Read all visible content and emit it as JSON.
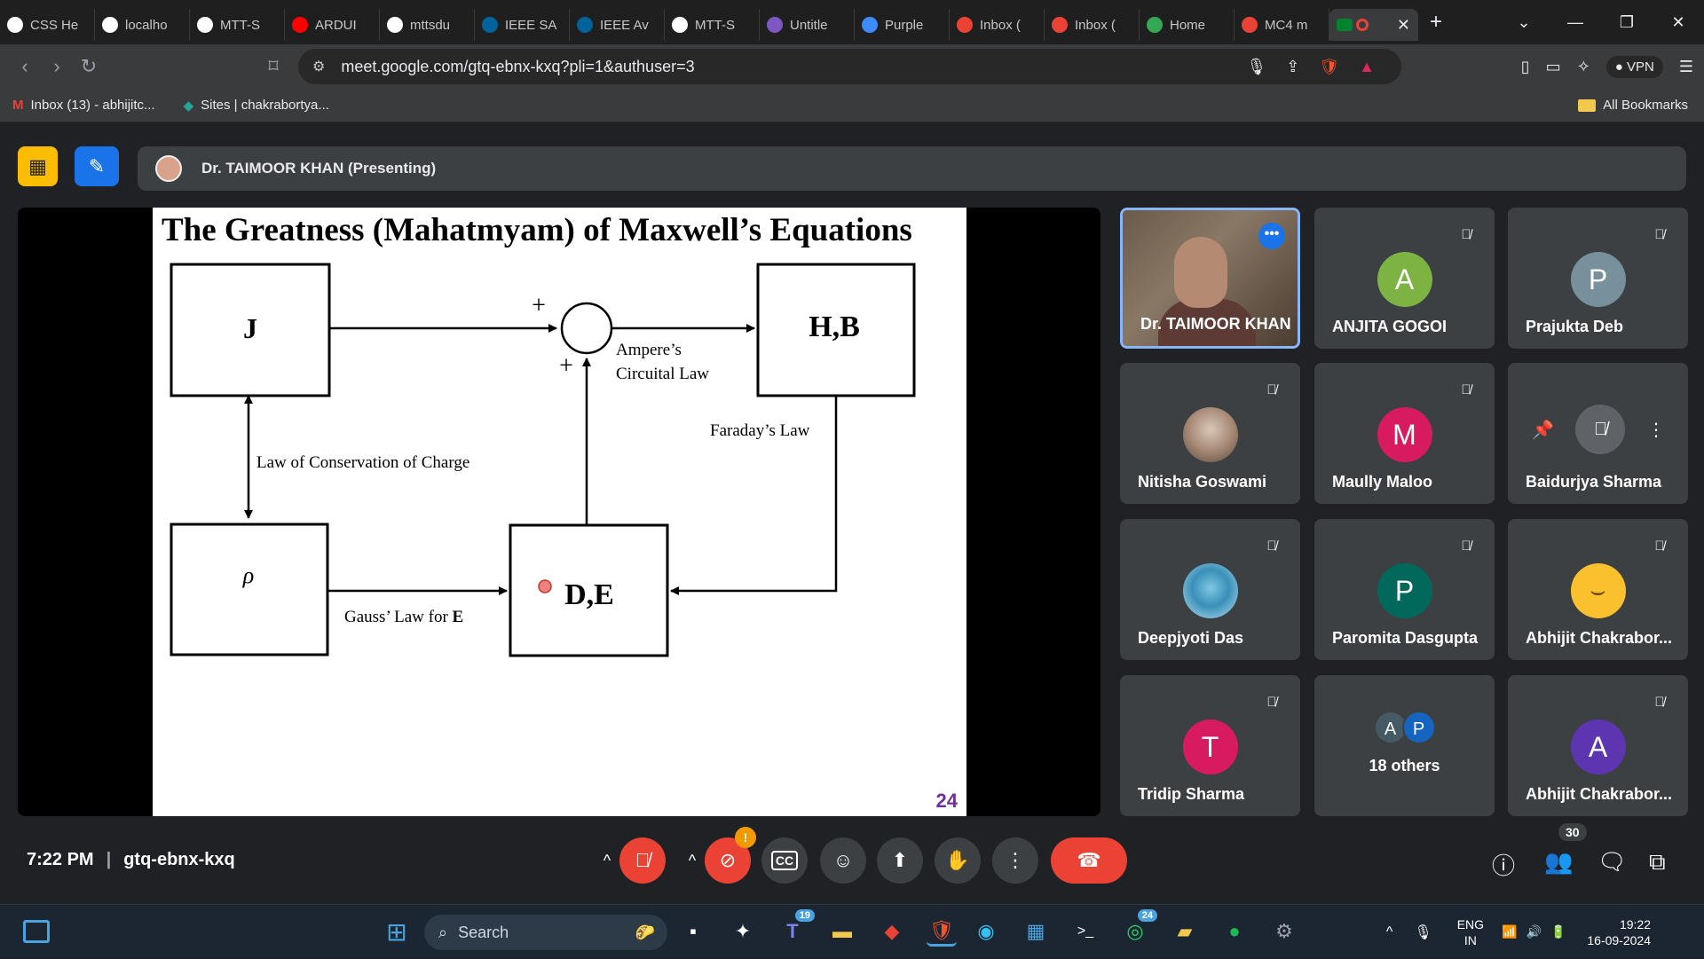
{
  "browser": {
    "tabs": [
      {
        "label": "CSS He",
        "icon": "openai-icon",
        "color": "#ffffff"
      },
      {
        "label": "localho",
        "icon": "globe-icon",
        "color": "#ffffff"
      },
      {
        "label": "MTT-S",
        "icon": "openai-icon",
        "color": "#ffffff"
      },
      {
        "label": "ARDUI",
        "icon": "youtube-icon",
        "color": "#ff0000"
      },
      {
        "label": "mttsdu",
        "icon": "triangle-icon",
        "color": "#ffffff"
      },
      {
        "label": "IEEE SA",
        "icon": "ieee-icon",
        "color": "#00629b"
      },
      {
        "label": "IEEE Av",
        "icon": "ieee-icon",
        "color": "#00629b"
      },
      {
        "label": "MTT-S",
        "icon": "openai-icon",
        "color": "#ffffff"
      },
      {
        "label": "Untitle",
        "icon": "forms-icon",
        "color": "#7e57c2"
      },
      {
        "label": "Purple",
        "icon": "chat-icon",
        "color": "#3d8bfd"
      },
      {
        "label": "Inbox (",
        "icon": "gmail-icon",
        "color": "#ea4335"
      },
      {
        "label": "Inbox (",
        "icon": "gmail-icon",
        "color": "#ea4335"
      },
      {
        "label": "Home",
        "icon": "drive-icon",
        "color": "#34a853"
      },
      {
        "label": "MC4 m",
        "icon": "record-icon",
        "color": "#ea4335"
      }
    ],
    "url": "meet.google.com/gtq-ebnx-kxq?pli=1&authuser=3",
    "vpn_label": "VPN",
    "bookmarks": [
      {
        "label": "Inbox (13) - abhijitc...",
        "icon": "gmail-icon"
      },
      {
        "label": "Sites | chakrabortya...",
        "icon": "sites-icon"
      }
    ],
    "all_bookmarks": "All Bookmarks"
  },
  "meet": {
    "presenter_label": "Dr. TAIMOOR KHAN (Presenting)",
    "slide": {
      "title": "The Greatness (Mahatmyam) of Maxwell’s Equations",
      "box_j": "J",
      "box_hb": "H,B",
      "box_rho": "ρ",
      "box_de": "D,E",
      "plus1": "+",
      "plus2": "+",
      "ampere_line1": "Ampere’s",
      "ampere_line2": "Circuital Law",
      "faraday": "Faraday’s Law",
      "conservation": "Law of Conservation of Charge",
      "gauss_prefix": "Gauss’ Law for ",
      "gauss_bold": "E",
      "page_number": "24"
    },
    "participants": [
      {
        "name": "Dr. TAIMOOR KHAN",
        "type": "video",
        "speaking": true
      },
      {
        "name": "ANJITA GOGOI",
        "initial": "A",
        "color": "#7cb342",
        "muted": true
      },
      {
        "name": "Prajukta Deb",
        "initial": "P",
        "color": "#78909c",
        "muted": true
      },
      {
        "name": "Nitisha Goswami",
        "type": "photo",
        "muted": true
      },
      {
        "name": "Maully Maloo",
        "initial": "M",
        "color": "#d81b60",
        "muted": true
      },
      {
        "name": "Baidurjya Sharma",
        "type": "pinned",
        "muted": true
      },
      {
        "name": "Deepjyoti Das",
        "type": "photo-blue",
        "muted": true
      },
      {
        "name": "Paromita Dasgupta",
        "initial": "P",
        "color": "#00695c",
        "muted": true
      },
      {
        "name": "Abhijit Chakrabor...",
        "type": "emoji",
        "muted": true
      },
      {
        "name": "Tridip Sharma",
        "initial": "T",
        "color": "#d81b60",
        "muted": true
      },
      {
        "name": "18 others",
        "type": "others",
        "mini": [
          {
            "initial": "A",
            "color": "#455a64"
          },
          {
            "initial": "P",
            "color": "#1565c0"
          }
        ]
      },
      {
        "name": "Abhijit Chakrabor...",
        "initial": "A",
        "color": "#5e35b1",
        "muted": true
      }
    ],
    "time": "7:22 PM",
    "meeting_code": "gtq-ebnx-kxq",
    "people_count": "30",
    "camera_badge": "!"
  },
  "taskbar": {
    "search_placeholder": "Search",
    "teams_badge": "19",
    "whatsapp_badge": "24",
    "lang_line1": "ENG",
    "lang_line2": "IN",
    "time": "19:22",
    "date": "16-09-2024"
  }
}
